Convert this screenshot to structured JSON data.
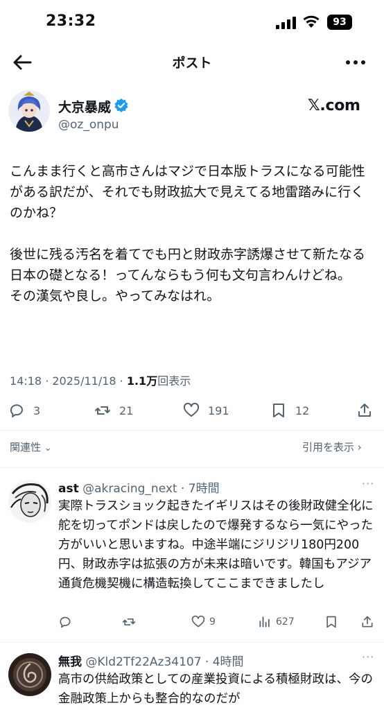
{
  "status_bar": {
    "time": "23:32",
    "battery": "93"
  },
  "header": {
    "title": "ポスト"
  },
  "post": {
    "author_name": "大京暴威",
    "author_handle": "@oz_onpu",
    "brand": "𝕏.com",
    "body": "こんまま行くと高市さんはマジで日本版トラスになる可能性がある訳だが、それでも財政拡大で見えてる地雷踏みに行くのかね？\n\n後世に残る汚名を着てでも円と財政赤字誘爆させて新たなる日本の礎となる！ってんならもう何も文句言わんけどね。\nその漢気や良し。やってみなはれ。",
    "meta_time": "14:18 · 2025/11/18 · ",
    "meta_views": "1.1万",
    "meta_views_label": "回表示",
    "replies": "3",
    "reposts": "21",
    "likes": "191",
    "bookmarks": "12"
  },
  "related_label": "関連性",
  "quotes_label": "引用を表示",
  "replies": [
    {
      "name": "ast",
      "handle": "@akracing_next · 7時間",
      "body": "実際トラスショック起きたイギリスはその後財政健全化に舵を切ってポンドは戻したので爆発するなら一気にやった方がいいと思いますね。中途半端にジリジリ180円200円、財政赤字は拡張の方が未来は暗いです。韓国もアジア通貨危機契機に構造転換してここまできましたし",
      "replies": "",
      "reposts": "",
      "likes": "9",
      "views": "627"
    },
    {
      "name": "無我",
      "handle": "@Kld2Tf22Az34107 · 4時間",
      "body": "高市の供給政策としての産業投資による積極財政は、今の金融政策上からも整合的なのだが"
    }
  ],
  "colors": {
    "accent": "#1d9bf0",
    "text": "#0f1419",
    "muted": "#536471"
  }
}
